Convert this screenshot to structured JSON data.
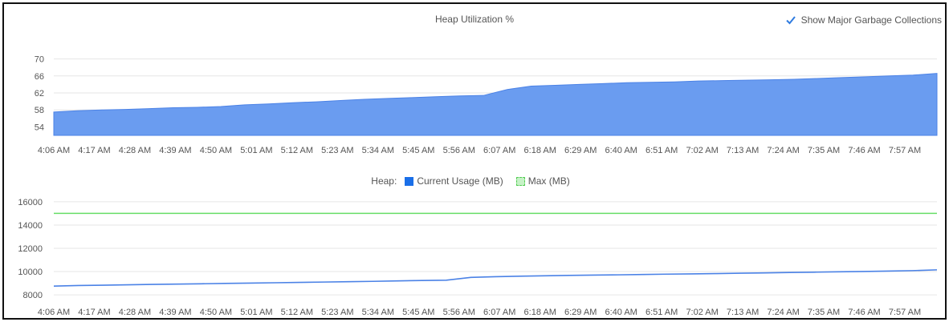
{
  "colors": {
    "area_fill": "#6a9cf0",
    "area_stroke": "#4b82e6",
    "current_line": "#4b82e6",
    "max_line": "#66dd66",
    "grid": "#e6e6e6",
    "text": "#555555",
    "check": "#2f7be0"
  },
  "top_chart": {
    "title": "Heap Utilization %",
    "gc_toggle_label": "Show Major Garbage Collections",
    "gc_toggle_checked": true
  },
  "legend": {
    "prefix": "Heap:",
    "current_label": "Current Usage (MB)",
    "max_label": "Max (MB)"
  },
  "chart_data": [
    {
      "type": "area",
      "title": "Heap Utilization %",
      "x_ticks": [
        "4:06 AM",
        "4:17 AM",
        "4:28 AM",
        "4:39 AM",
        "4:50 AM",
        "5:01 AM",
        "5:12 AM",
        "5:23 AM",
        "5:34 AM",
        "5:45 AM",
        "5:56 AM",
        "6:07 AM",
        "6:18 AM",
        "6:29 AM",
        "6:40 AM",
        "6:51 AM",
        "7:02 AM",
        "7:13 AM",
        "7:24 AM",
        "7:35 AM",
        "7:46 AM",
        "7:57 AM"
      ],
      "y_ticks": [
        54,
        58,
        62,
        66,
        70
      ],
      "ylim": [
        52,
        72
      ],
      "grid": true,
      "series": [
        {
          "values": [
            57.5,
            57.8,
            58.0,
            58.1,
            58.3,
            58.5,
            58.6,
            58.8,
            59.2,
            59.4,
            59.7,
            59.9,
            60.2,
            60.5,
            60.7,
            60.9,
            61.1,
            61.3,
            61.4,
            62.8,
            63.6,
            63.8,
            64.0,
            64.2,
            64.4,
            64.5,
            64.6,
            64.8,
            64.9,
            65.0,
            65.1,
            65.2,
            65.4,
            65.6,
            65.8,
            66.0,
            66.2,
            66.6
          ]
        }
      ]
    },
    {
      "type": "line",
      "x_ticks": [
        "4:06 AM",
        "4:17 AM",
        "4:28 AM",
        "4:39 AM",
        "4:50 AM",
        "5:01 AM",
        "5:12 AM",
        "5:23 AM",
        "5:34 AM",
        "5:45 AM",
        "5:56 AM",
        "6:07 AM",
        "6:18 AM",
        "6:29 AM",
        "6:40 AM",
        "6:51 AM",
        "7:02 AM",
        "7:13 AM",
        "7:24 AM",
        "7:35 AM",
        "7:46 AM",
        "7:57 AM"
      ],
      "y_ticks": [
        8000,
        10000,
        12000,
        14000,
        16000
      ],
      "ylim": [
        7800,
        16200
      ],
      "grid": true,
      "legend_position": "top-center",
      "series": [
        {
          "name": "Current Usage (MB)",
          "values": [
            8750,
            8800,
            8830,
            8860,
            8900,
            8920,
            8950,
            8980,
            9010,
            9040,
            9070,
            9100,
            9130,
            9160,
            9200,
            9230,
            9260,
            9500,
            9560,
            9600,
            9640,
            9670,
            9700,
            9720,
            9750,
            9780,
            9800,
            9830,
            9860,
            9890,
            9920,
            9950,
            9980,
            10010,
            10040,
            10080,
            10150
          ]
        },
        {
          "name": "Max (MB)",
          "values": [
            15000,
            15000
          ]
        }
      ]
    }
  ]
}
